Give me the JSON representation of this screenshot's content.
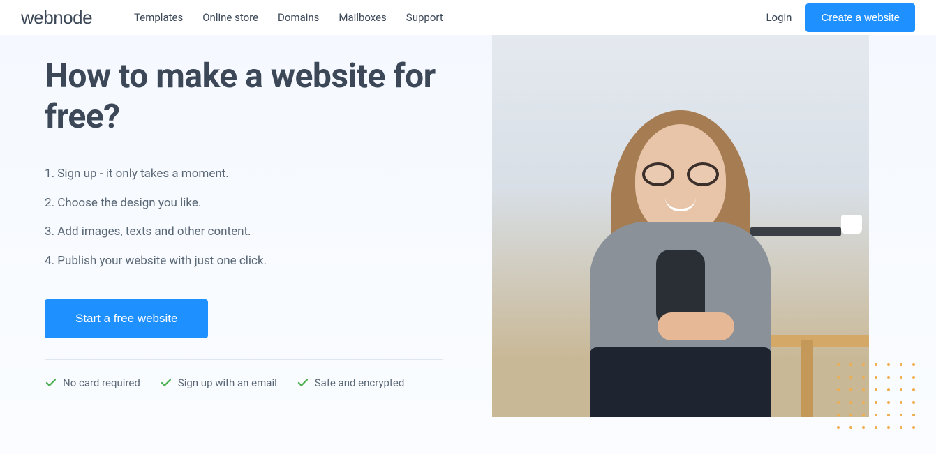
{
  "brand": "webnode",
  "nav": {
    "items": [
      "Templates",
      "Online store",
      "Domains",
      "Mailboxes",
      "Support"
    ]
  },
  "header": {
    "login": "Login",
    "cta": "Create a website"
  },
  "hero": {
    "title": "How to make a website for free?",
    "steps": [
      "Sign up - it only takes a moment.",
      "Choose the design you like.",
      "Add images, texts and other content.",
      "Publish your website with just one click."
    ],
    "cta": "Start a free website",
    "features": [
      "No card required",
      "Sign up with an email",
      "Safe and encrypted"
    ]
  },
  "colors": {
    "primary": "#1e90ff",
    "text": "#3c4858",
    "muted": "#5a6775",
    "check": "#4caf50",
    "accent": "#f0ad4e"
  }
}
